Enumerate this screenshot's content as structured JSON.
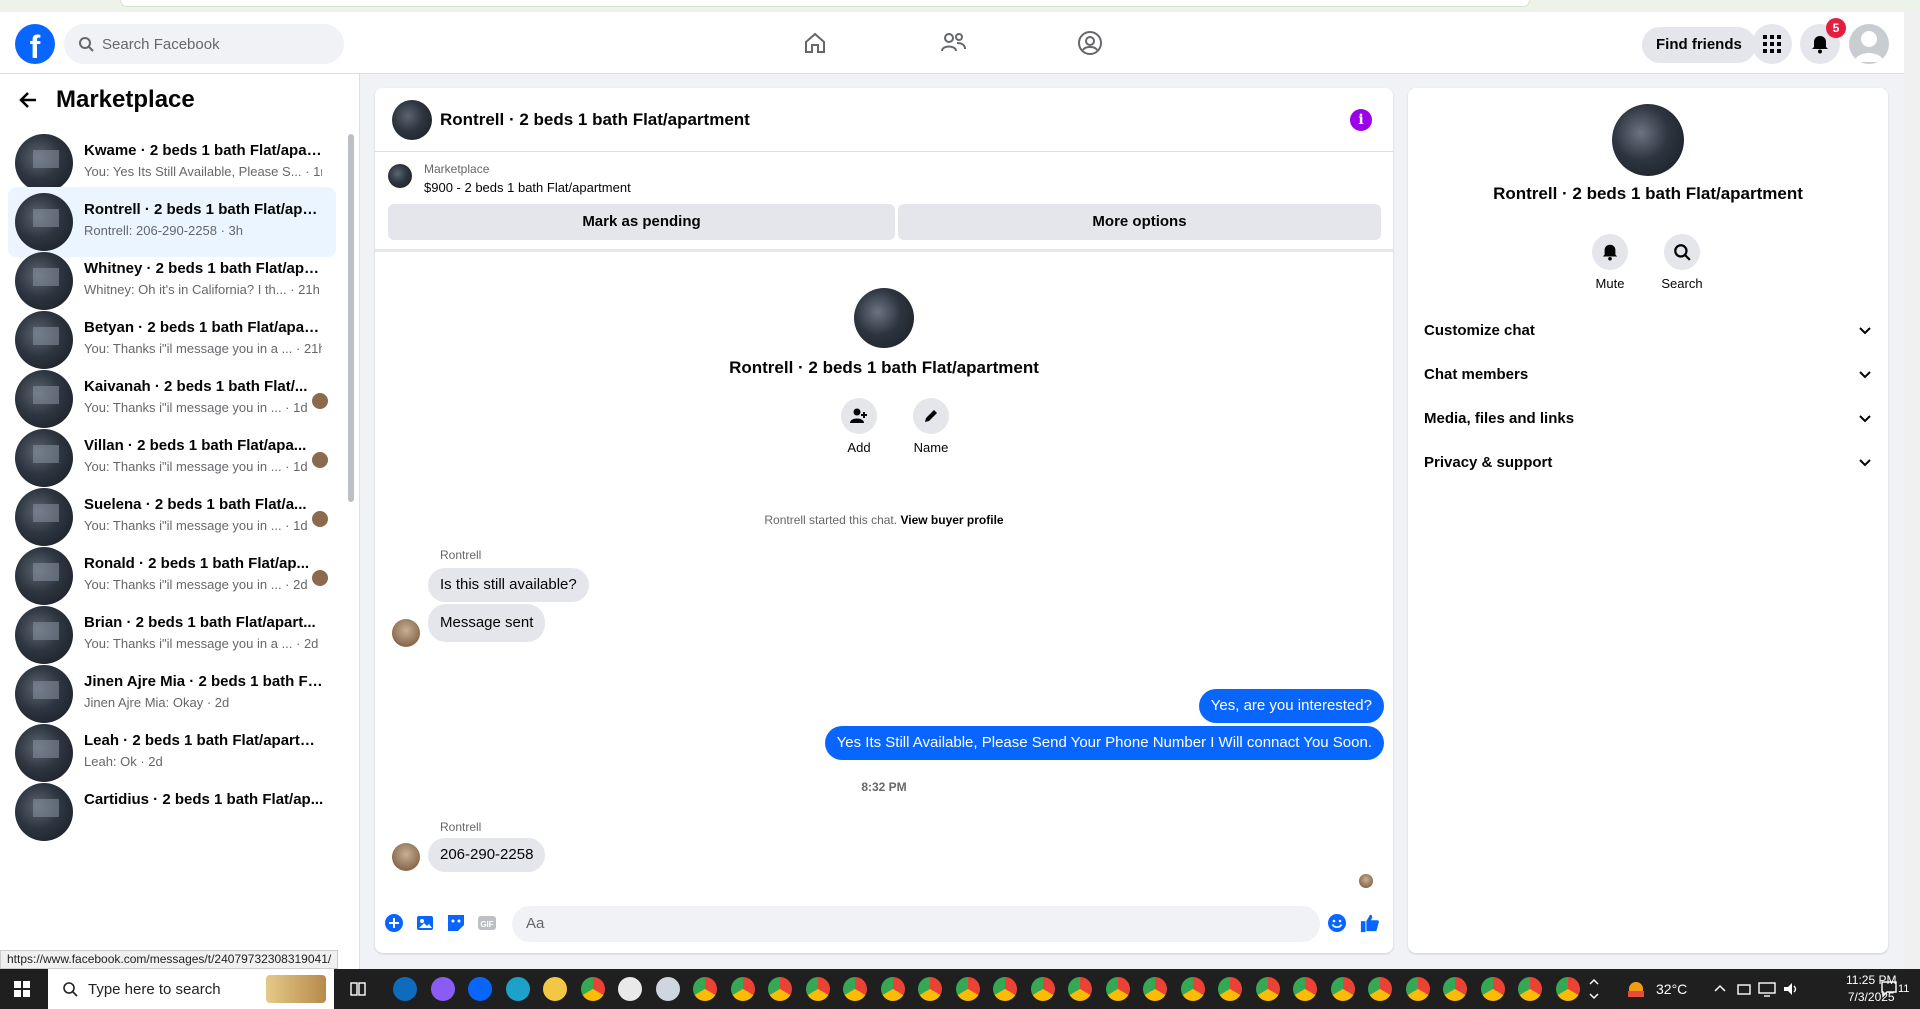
{
  "browser": {
    "status_url": "https://www.facebook.com/messages/t/24079732308319041/"
  },
  "topnav": {
    "search_placeholder": "Search Facebook",
    "find_friends": "Find friends",
    "notification_count": "5",
    "brand_color": "#0866ff"
  },
  "sidebar": {
    "title": "Marketplace",
    "conversations": [
      {
        "title": "Kwame · 2 beds 1 bath Flat/apar...",
        "preview": "You: Yes Its Still Available, Please S... · 1m",
        "active": false,
        "seen": false
      },
      {
        "title": "Rontrell · 2 beds 1 bath Flat/apar...",
        "preview": "Rontrell: 206-290-2258 · 3h",
        "active": true,
        "seen": false
      },
      {
        "title": "Whitney · 2 beds 1 bath Flat/apa...",
        "preview": "Whitney: Oh it's in California? I th... · 21h",
        "active": false,
        "seen": false
      },
      {
        "title": "Betyan · 2 beds 1 bath Flat/apart...",
        "preview": "You: Thanks i\"il message you in a ... · 21h",
        "active": false,
        "seen": false
      },
      {
        "title": "Kaivanah · 2 beds 1 bath Flat/...",
        "preview": "You: Thanks i\"il message you in ... · 1d",
        "active": false,
        "seen": true
      },
      {
        "title": "Villan · 2 beds 1 bath Flat/apa...",
        "preview": "You: Thanks i\"il message you in ... · 1d",
        "active": false,
        "seen": true
      },
      {
        "title": "Suelena · 2 beds 1 bath Flat/a...",
        "preview": "You: Thanks i\"il message you in ... · 1d",
        "active": false,
        "seen": true
      },
      {
        "title": "Ronald · 2 beds 1 bath Flat/ap...",
        "preview": "You: Thanks i\"il message you in ... · 2d",
        "active": false,
        "seen": true
      },
      {
        "title": "Brian · 2 beds 1 bath Flat/apart...",
        "preview": "You: Thanks i\"il message you in a ... · 2d",
        "active": false,
        "seen": false
      },
      {
        "title": "Jinen Ajre Mia · 2 beds 1 bath Fl...",
        "preview": "Jinen Ajre Mia: Okay · 2d",
        "active": false,
        "seen": false
      },
      {
        "title": "Leah · 2 beds 1 bath Flat/apartm...",
        "preview": "Leah: Ok · 2d",
        "active": false,
        "seen": false
      },
      {
        "title": "Cartidius · 2 beds 1 bath Flat/ap...",
        "preview": "",
        "active": false,
        "seen": false
      }
    ]
  },
  "chat": {
    "title": "Rontrell · 2 beds 1 bath Flat/apartment",
    "marketplace_label": "Marketplace",
    "listing": "$900 - 2 beds 1 bath Flat/apartment",
    "mark_pending": "Mark as pending",
    "more_options": "More options",
    "center_name": "Rontrell · 2 beds 1 bath Flat/apartment",
    "add_label": "Add",
    "name_label": "Name",
    "started_text": "Rontrell started this chat.",
    "view_profile": "View buyer profile",
    "sender": "Rontrell",
    "msg1": "Is this still available?",
    "msg2": "Message sent",
    "out1": "Yes, are you interested?",
    "out2": "Yes Its Still Available, Please Send Your Phone Number I Will connact You Soon.",
    "time": "8:32 PM",
    "sender2": "Rontrell",
    "msg3": "206-290-2258",
    "composer_placeholder": "Aa",
    "outgoing_color": "#0866ff"
  },
  "details": {
    "name": "Rontrell · 2 beds 1 bath Flat/apartment",
    "mute": "Mute",
    "search": "Search",
    "sections": [
      "Customize chat",
      "Chat members",
      "Media, files and links",
      "Privacy & support"
    ]
  },
  "taskbar": {
    "search_placeholder": "Type here to search",
    "weather": "32°C",
    "time": "11:25 PM",
    "date": "7/3/2025",
    "notif_count": "11"
  }
}
